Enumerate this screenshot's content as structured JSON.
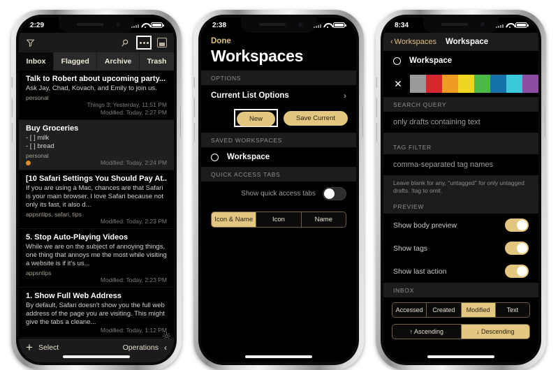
{
  "phone1": {
    "status": {
      "time": "2:29"
    },
    "toolbar": {
      "filter_icon": "filter-funnel-icon",
      "search_icon": "search-icon",
      "more_icon": "more-ellipsis-icon",
      "panel_icon": "panel-toggle-icon"
    },
    "tabs": [
      {
        "label": "Inbox",
        "active": true
      },
      {
        "label": "Flagged",
        "active": false
      },
      {
        "label": "Archive",
        "active": false
      },
      {
        "label": "Trash",
        "active": false
      }
    ],
    "drafts": [
      {
        "title": "Talk to Robert about upcoming party...",
        "body": "Ask Jay, Chad, Kovach, and Emily to join us.",
        "tags": "personal",
        "meta1": "Things 3: Yesterday, 11:51 PM",
        "meta2": "Modified: Today, 2:27 PM",
        "flag": false,
        "selected": false
      },
      {
        "title": "Buy Groceries",
        "body": "- [ ] milk\n- [ ] bread",
        "tags": "personal",
        "meta1": "",
        "meta2": "Modified: Today, 2:24 PM",
        "flag": true,
        "selected": true
      },
      {
        "title": "[10 Safari Settings You Should Pay At...",
        "body": "If you are using a Mac, chances are that Safari is your main browser. I love Safari because not only its fast, it also d...",
        "tags": "appsntips, safari, tips",
        "meta1": "",
        "meta2": "Modified: Today, 2:23 PM",
        "flag": false,
        "selected": false
      },
      {
        "title": "5. Stop Auto-Playing Videos",
        "body": "While we are on the subject of annoying things, one thing that annoys me the most while visiting a website is if it's us...",
        "tags": "appsntips",
        "meta1": "",
        "meta2": "Modified: Today, 2:23 PM",
        "flag": false,
        "selected": false
      },
      {
        "title": "1. Show Full Web Address",
        "body": "By default, Safari doesn't show you the full web address of the page you are visiting. This might give the tabs a cleane...",
        "tags": "",
        "meta1": "",
        "meta2": "Modified: Today, 1:12 PM",
        "flag": false,
        "selected": false
      }
    ],
    "bottom": {
      "add_icon": "plus-icon",
      "select_label": "Select",
      "operations_label": "Operations",
      "chevron_icon": "chevron-left-icon",
      "gear_icon": "gear-icon"
    }
  },
  "phone2": {
    "status": {
      "time": "2:38"
    },
    "nav": {
      "done_label": "Done"
    },
    "title": "Workspaces",
    "sections": {
      "options_header": "OPTIONS",
      "saved_header": "SAVED WORKSPACES",
      "quick_header": "QUICK ACCESS TABS"
    },
    "current_list_options": "Current List Options",
    "buttons": {
      "new_label": "New",
      "save_current_label": "Save Current"
    },
    "saved_workspace": "Workspace",
    "quick_access": {
      "toggle_label": "Show quick access tabs",
      "toggle_on": false,
      "segments": [
        {
          "label": "Icon & Name",
          "active": true
        },
        {
          "label": "Icon",
          "active": false
        },
        {
          "label": "Name",
          "active": false
        }
      ]
    }
  },
  "phone3": {
    "status": {
      "time": "8:34"
    },
    "nav": {
      "back_label": "Workspaces",
      "title": "Workspace"
    },
    "workspace_name": "Workspace",
    "colors": {
      "clear_icon": "close-x-icon",
      "swatches": [
        "#9a9a9a",
        "#d6272e",
        "#ef9a23",
        "#edd520",
        "#4cb848",
        "#1272a8",
        "#3cc7d8",
        "#8c4da0"
      ]
    },
    "search_query": {
      "header": "SEARCH QUERY",
      "placeholder": "only drafts containing text"
    },
    "tag_filter": {
      "header": "TAG FILTER",
      "placeholder": "comma-separated tag names",
      "hint": "Leave blank for any, \"untagged\" for only untagged drafts. !tag to omit."
    },
    "preview": {
      "header": "PREVIEW",
      "rows": [
        {
          "label": "Show body preview",
          "on": true
        },
        {
          "label": "Show tags",
          "on": true
        },
        {
          "label": "Show last action",
          "on": true
        }
      ]
    },
    "inbox": {
      "header": "INBOX",
      "sort_fields": [
        {
          "label": "Accessed",
          "active": false
        },
        {
          "label": "Created",
          "active": false
        },
        {
          "label": "Modified",
          "active": true
        },
        {
          "label": "Text",
          "active": false
        }
      ],
      "sort_order": [
        {
          "label": "↑ Ascending",
          "active": false
        },
        {
          "label": "↓ Descending",
          "active": true
        }
      ]
    }
  },
  "theme": {
    "accent": "#e3c67f",
    "screen_bg": "#000000",
    "section_bg": "#1c1c1c"
  }
}
